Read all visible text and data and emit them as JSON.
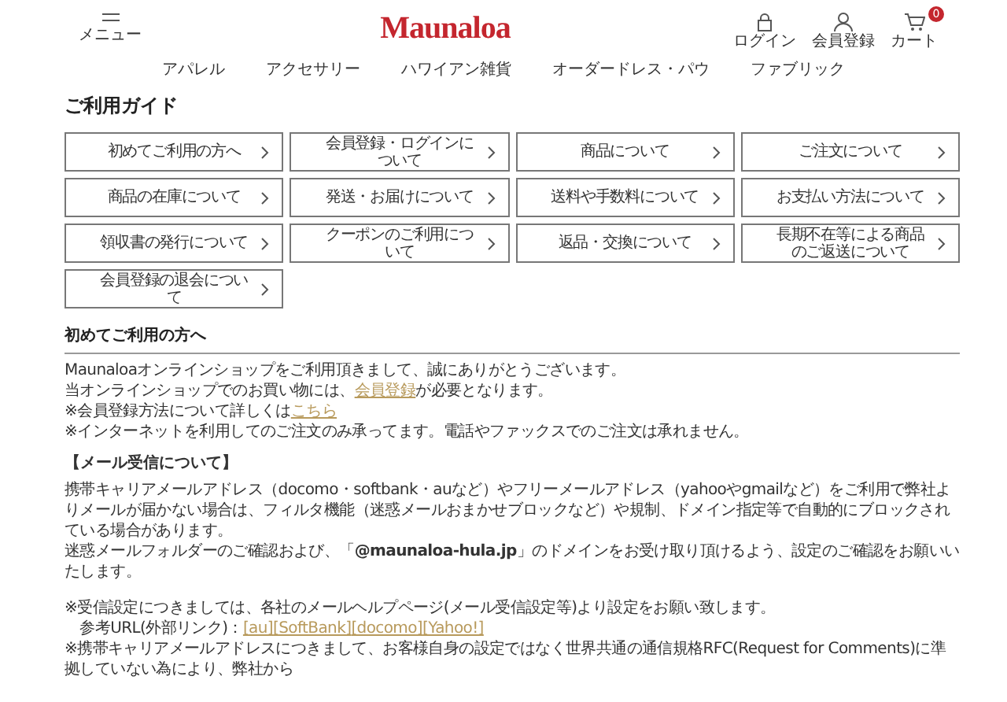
{
  "header": {
    "menu_label": "メニュー",
    "logo": "Maunaloa",
    "actions": [
      {
        "kind": "login",
        "label": "ログイン"
      },
      {
        "kind": "member",
        "label": "会員登録"
      },
      {
        "kind": "cart",
        "label": "カート",
        "badge": "0"
      }
    ]
  },
  "nav": [
    "アパレル",
    "アクセサリー",
    "ハワイアン雑貨",
    "オーダードレス・パウ",
    "ファブリック"
  ],
  "page_title": "ご利用ガイド",
  "guide_buttons": [
    "初めてご利用の方へ",
    "会員登録・ログインについて",
    "商品について",
    "ご注文について",
    "商品の在庫について",
    "発送・お届けについて",
    "送料や手数料について",
    "お支払い方法について",
    "領収書の発行について",
    "クーポンのご利用について",
    "返品・交換について",
    "長期不在等による商品のご返送について",
    "会員登録の退会について"
  ],
  "section": {
    "heading": "初めてご利用の方へ",
    "blocks": [
      {
        "kind": "para",
        "lines": [
          [
            {
              "text": "Maunaloaオンラインショップをご利用頂きまして、誠にありがとうございます。"
            }
          ],
          [
            {
              "text": "当オンラインショップでのお買い物には、"
            },
            {
              "text": "会員登録",
              "link": true
            },
            {
              "text": "が必要となります。"
            }
          ],
          [
            {
              "text": "※会員登録方法について詳しくは"
            },
            {
              "text": "こちら",
              "link": true
            }
          ],
          [
            {
              "text": "※インターネットを利用してのご注文のみ承ってます。電話やファックスでのご注文は承れません。"
            }
          ]
        ]
      },
      {
        "kind": "subheading",
        "text": "【メール受信について】"
      },
      {
        "kind": "para",
        "lines": [
          [
            {
              "text": "携帯キャリアメールアドレス（docomo・softbank・auなど）やフリーメールアドレス（yahooやgmailなど）をご利用で弊社よりメールが届かない場合は、フィルタ機能（迷惑メールおまかせブロックなど）や規制、ドメイン指定等で自動的にブロックされている場合があります。"
            }
          ],
          [
            {
              "text": "迷惑メールフォルダーのご確認および、「**@maunaloa-hula.jp**」のドメインをお受け取り頂けるよう、設定のご確認をお願いいたします。"
            }
          ]
        ]
      },
      {
        "kind": "para",
        "lines": [
          [
            {
              "text": "※受信設定につきましては、各社のメールヘルプページ(メール受信設定等)より設定をお願い致します。"
            }
          ],
          [
            {
              "text": "　参考URL(外部リンク)："
            },
            {
              "text": "[au]",
              "link": true
            },
            {
              "text": "[SoftBank]",
              "link": true
            },
            {
              "text": "[docomo]",
              "link": true
            },
            {
              "text": "[Yahoo!]",
              "link": true
            }
          ],
          [
            {
              "text": "※携帯キャリアメールアドレスにつきまして、お客様自身の設定ではなく世界共通の通信規格RFC(Request for Comments)に準拠していない為により、弊社から"
            }
          ]
        ]
      }
    ]
  }
}
